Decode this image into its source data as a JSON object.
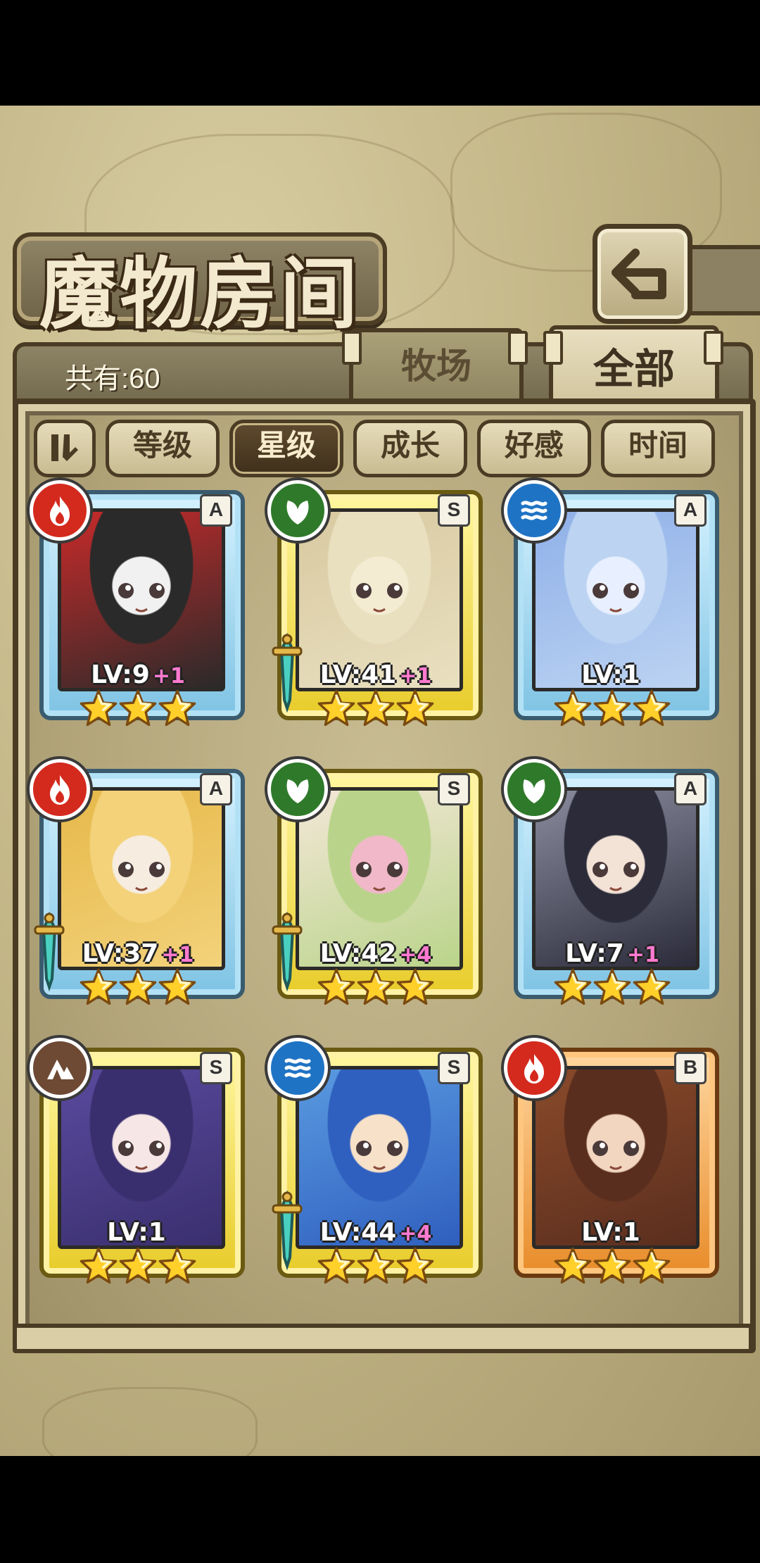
{
  "header": {
    "title": "魔物房间",
    "back_icon": "back-arrow-icon"
  },
  "tabs": {
    "count_label": "共有:60",
    "items": [
      {
        "label": "牧场",
        "active": false
      },
      {
        "label": "全部",
        "active": true
      }
    ]
  },
  "sort_bar": {
    "toggle_icon": "sort-order-icon",
    "options": [
      {
        "label": "等级",
        "active": false
      },
      {
        "label": "星级",
        "active": true
      },
      {
        "label": "成长",
        "active": false
      },
      {
        "label": "好感",
        "active": false
      },
      {
        "label": "时间",
        "active": false
      }
    ]
  },
  "monsters": [
    {
      "element": "fire",
      "rank": "A",
      "frame": "blue",
      "level": "LV:9",
      "plus": "+1",
      "stars": 3,
      "has_sword": false,
      "portrait_colors": [
        "#2a2a2a",
        "#c92a2a",
        "#f1f1f1"
      ]
    },
    {
      "element": "nature",
      "rank": "S",
      "frame": "gold",
      "level": "LV:41",
      "plus": "+1",
      "stars": 3,
      "has_sword": true,
      "portrait_colors": [
        "#e9e0c0",
        "#d8c9a0",
        "#f4ecd2"
      ]
    },
    {
      "element": "water",
      "rank": "A",
      "frame": "blue",
      "level": "LV:1",
      "plus": "",
      "stars": 3,
      "has_sword": false,
      "portrait_colors": [
        "#bcd3f2",
        "#8fb0e8",
        "#e8f0ff"
      ]
    },
    {
      "element": "fire",
      "rank": "A",
      "frame": "blue",
      "level": "LV:37",
      "plus": "+1",
      "stars": 3,
      "has_sword": true,
      "portrait_colors": [
        "#f3d27a",
        "#e6b84a",
        "#f6ede0"
      ]
    },
    {
      "element": "nature",
      "rank": "S",
      "frame": "gold",
      "level": "LV:42",
      "plus": "+4",
      "stars": 3,
      "has_sword": true,
      "portrait_colors": [
        "#b9d48a",
        "#f4e7d8",
        "#f0b8c8"
      ]
    },
    {
      "element": "nature",
      "rank": "A",
      "frame": "blue",
      "level": "LV:7",
      "plus": "+1",
      "stars": 3,
      "has_sword": false,
      "portrait_colors": [
        "#2b2b3a",
        "#8a8c9e",
        "#f3e2d6"
      ]
    },
    {
      "element": "earth",
      "rank": "S",
      "frame": "gold",
      "level": "LV:1",
      "plus": "",
      "stars": 3,
      "has_sword": false,
      "portrait_colors": [
        "#3a2f6e",
        "#5a4a9e",
        "#f6e6e6"
      ]
    },
    {
      "element": "water",
      "rank": "S",
      "frame": "gold",
      "level": "LV:44",
      "plus": "+4",
      "stars": 3,
      "has_sword": true,
      "portrait_colors": [
        "#2f5fbf",
        "#5a9ae0",
        "#f7e1c8"
      ]
    },
    {
      "element": "fire",
      "rank": "B",
      "frame": "orange",
      "level": "LV:1",
      "plus": "",
      "stars": 3,
      "has_sword": false,
      "portrait_colors": [
        "#5a2e1e",
        "#8a4a2a",
        "#f2d6c0"
      ]
    }
  ],
  "colors": {
    "fire": "#d42a1e",
    "nature": "#2f7a2a",
    "water": "#1f73c4",
    "earth": "#6e4a34",
    "star": "#ffcf2a"
  }
}
